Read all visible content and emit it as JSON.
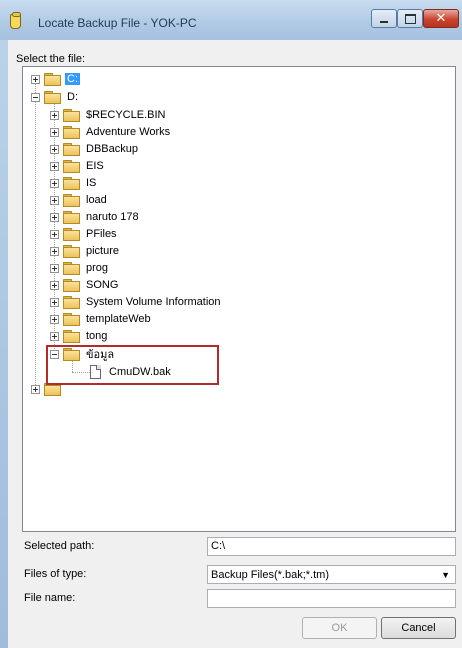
{
  "window": {
    "title": "Locate Backup File - YOK-PC",
    "minimize_label": "",
    "maximize_label": "",
    "close_label": "✕"
  },
  "dialog": {
    "select_label": "Select the file:",
    "selected_path_label": "Selected path:",
    "selected_path_value": "C:\\",
    "files_of_type_label": "Files of type:",
    "files_of_type_value": "Backup Files(*.bak;*.tm)",
    "file_name_label": "File name:",
    "file_name_value": "",
    "ok_label": "OK",
    "cancel_label": "Cancel"
  },
  "tree": {
    "drives": [
      {
        "label": "C:",
        "expanded": false,
        "selected": true
      },
      {
        "label": "D:",
        "expanded": true,
        "selected": false
      },
      {
        "label": "",
        "expanded": false,
        "selected": false
      }
    ],
    "d_children": [
      "$RECYCLE.BIN",
      "Adventure Works",
      "DBBackup",
      "EIS",
      "IS",
      "load",
      "naruto 178",
      "PFiles",
      "picture",
      "prog",
      "SONG",
      "System Volume Information",
      "templateWeb",
      "tong",
      "ข้อมูล"
    ],
    "file": "CmuDW.bak"
  },
  "icons": {
    "app": "backup-file-icon",
    "folder": "folder-icon",
    "file": "file-icon",
    "expand": "plus-expander-icon",
    "collapse": "minus-expander-icon"
  }
}
